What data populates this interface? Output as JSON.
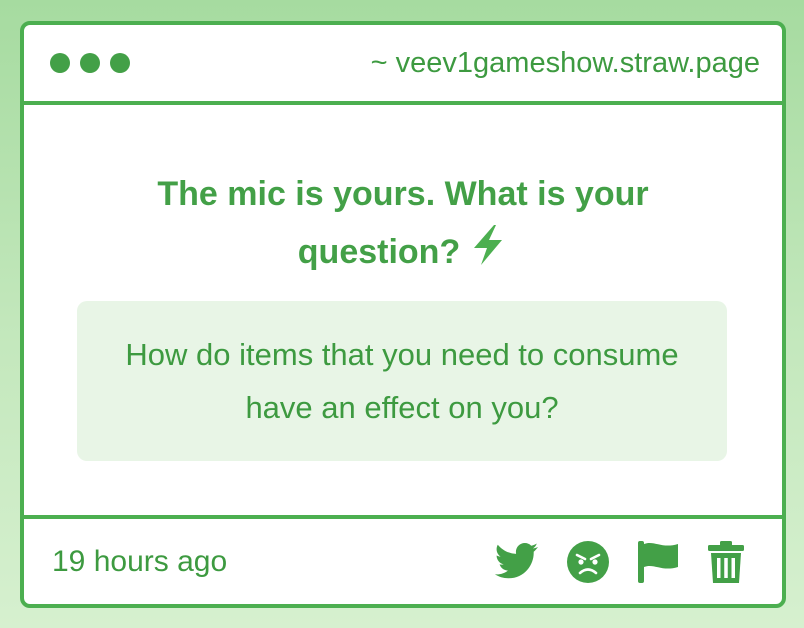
{
  "window": {
    "url": "~ veev1gameshow.straw.page",
    "dots": [
      "dot",
      "dot",
      "dot"
    ]
  },
  "prompt": {
    "text": "The mic is yours. What is your question?",
    "icon": "lightning-bolt-icon"
  },
  "answer": {
    "text": "How do items that you need to consume have an effect on you?"
  },
  "footer": {
    "timestamp": "19 hours ago",
    "actions": [
      "twitter-icon",
      "angry-face-icon",
      "flag-icon",
      "trash-icon"
    ]
  },
  "colors": {
    "accent": "#4caf50",
    "text_green": "#43a047",
    "answer_bg": "#e8f5e6",
    "background": "#a6dba0"
  }
}
